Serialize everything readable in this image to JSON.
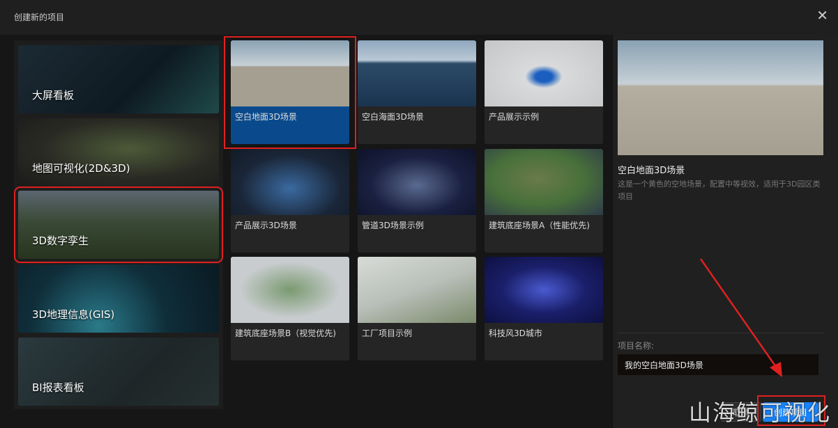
{
  "dialog": {
    "title": "创建新的项目",
    "close_icon": "close-icon"
  },
  "categories": [
    {
      "label": "大屏看板"
    },
    {
      "label": "地图可视化(2D&3D)"
    },
    {
      "label": "3D数字孪生"
    },
    {
      "label": "3D地理信息(GIS)"
    },
    {
      "label": "BI报表看板"
    }
  ],
  "templates": [
    {
      "label": "空白地面3D场景"
    },
    {
      "label": "空白海面3D场景"
    },
    {
      "label": "产品展示示例"
    },
    {
      "label": "产品展示3D场景"
    },
    {
      "label": "管道3D场景示例"
    },
    {
      "label": "建筑底座场景A（性能优先)"
    },
    {
      "label": "建筑底座场景B（视觉优先)"
    },
    {
      "label": "工厂项目示例"
    },
    {
      "label": "科技风3D城市"
    }
  ],
  "detail": {
    "title": "空白地面3D场景",
    "description": "这是一个黄色的空地场景，配置中等视效，适用于3D园区类项目",
    "name_label": "项目名称:",
    "name_value": "我的空白地面3D场景"
  },
  "buttons": {
    "cancel": "取消",
    "create": "创建项目"
  },
  "watermark": "山海鲸可视化"
}
